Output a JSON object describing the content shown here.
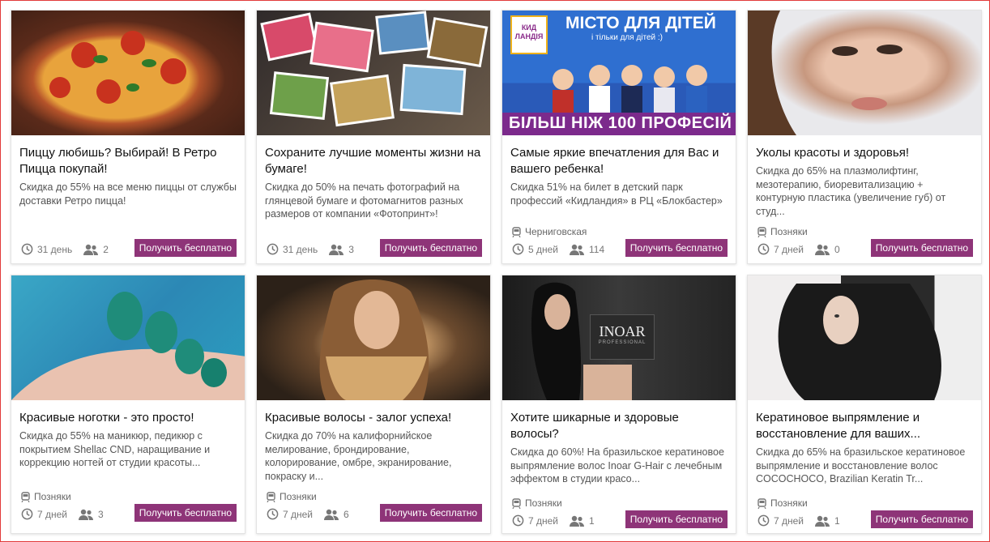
{
  "button_label": "Получить бесплатно",
  "accent_color": "#8e3478",
  "cards": [
    {
      "title": "Пиццу любишь? Выбирай! В Ретро Пицца покупай!",
      "desc": "Скидка до 55% на все меню пиццы от службы доставки Ретро пицца!",
      "location": "",
      "days": "31 день",
      "people": "2",
      "image": "pizza"
    },
    {
      "title": "Сохраните лучшие моменты жизни на бумаге!",
      "desc": "Скидка до 50% на печать фотографий на глянцевой бумаге и фотомагнитов разных размеров от компании «Фотопринт»!",
      "location": "",
      "days": "31 день",
      "people": "3",
      "image": "photos"
    },
    {
      "title": "Самые яркие впечатления для Вас и вашего ребенка!",
      "desc": "Скидка 51% на билет в детский парк профессий «Кидландия» в РЦ «Блокбастер»",
      "location": "Черниговская",
      "days": "5 дней",
      "people": "114",
      "image": "kids",
      "image_text_top": "МІСТО ДЛЯ ДІТЕЙ",
      "image_text_sub": "і тільки для дітей :)",
      "image_text_bottom": "БІЛЬШ НІЖ 100 ПРОФЕСІЙ",
      "logo_text": "КИД ЛАНДІЯ"
    },
    {
      "title": "Уколы красоты и здоровья!",
      "desc": "Скидка до 65% на плазмолифтинг, мезотерапию, биоревитализацию + контурную пластика (увеличение губ) от студ...",
      "location": "Позняки",
      "days": "7 дней",
      "people": "0",
      "image": "face"
    },
    {
      "title": "Красивые ноготки - это просто!",
      "desc": "Скидка до 55% на маникюр, педикюр с покрытием Shellac CND, наращивание и коррекцию ногтей от студии красоты...",
      "location": "Позняки",
      "days": "7 дней",
      "people": "3",
      "image": "nails"
    },
    {
      "title": "Красивые волосы - залог успеха!",
      "desc": "Скидка до 70% на калифорнийское мелирование, брондирование, колорирование, омбре, экранирование, покраску и...",
      "location": "Позняки",
      "days": "7 дней",
      "people": "6",
      "image": "hair1"
    },
    {
      "title": "Хотите шикарные и здоровые волосы?",
      "desc": "Скидка до 60%! На бразильское кератиновое выпрямление волос Inoar G-Hair с лечебным эффектом в студии красо...",
      "location": "Позняки",
      "days": "7 дней",
      "people": "1",
      "image": "hair2",
      "image_text_top": "INOAR",
      "image_text_sub": "PROFESSIONAL"
    },
    {
      "title": "Кератиновое выпрямление и восстановление для ваших...",
      "desc": "Скидка до 65% на бразильское кератиновое выпрямление и восстановление волос COCOCHOCO, Brazilian Keratin Tr...",
      "location": "Позняки",
      "days": "7 дней",
      "people": "1",
      "image": "hair3"
    }
  ]
}
